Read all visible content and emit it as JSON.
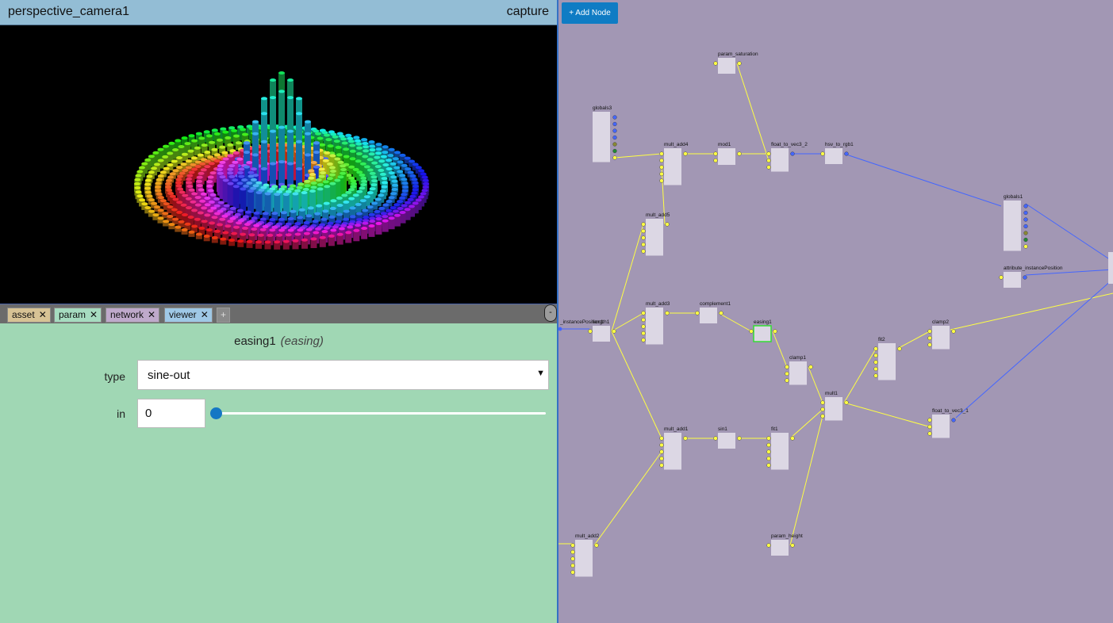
{
  "viewer": {
    "title": "perspective_camera1",
    "capture_label": "capture"
  },
  "tabs": [
    {
      "label": "asset",
      "close": "✕"
    },
    {
      "label": "param",
      "close": "✕"
    },
    {
      "label": "network",
      "close": "✕"
    },
    {
      "label": "viewer",
      "close": "✕"
    }
  ],
  "tab_add_label": "+",
  "collapse_label": "-",
  "param": {
    "node_name": "easing1",
    "node_type": "(easing)",
    "type_label": "type",
    "type_value": "sine-out",
    "in_label": "in",
    "in_value": "0",
    "in_slider_fraction": 0
  },
  "network": {
    "add_node_label": "+ Add Node",
    "nodes": [
      {
        "id": "param_saturation",
        "label": "param_saturation"
      },
      {
        "id": "globals3",
        "label": "globals3"
      },
      {
        "id": "mult_add4",
        "label": "mult_add4"
      },
      {
        "id": "mod1",
        "label": "mod1"
      },
      {
        "id": "float_to_vec3_2",
        "label": "float_to_vec3_2"
      },
      {
        "id": "hsv_to_rgb1",
        "label": "hsv_to_rgb1"
      },
      {
        "id": "globals1",
        "label": "globals1"
      },
      {
        "id": "mult_add5",
        "label": "mult_add5"
      },
      {
        "id": "attribute_instancePosition",
        "label": "attribute_instancePosition"
      },
      {
        "id": "length1",
        "label": "length1"
      },
      {
        "id": "instancePosition_partial",
        "label": "_instancePosition1"
      },
      {
        "id": "mult_add3",
        "label": "mult_add3"
      },
      {
        "id": "complement1",
        "label": "complement1"
      },
      {
        "id": "easing1",
        "label": "easing1"
      },
      {
        "id": "clamp2",
        "label": "clamp2"
      },
      {
        "id": "fit2",
        "label": "fit2"
      },
      {
        "id": "clamp1",
        "label": "clamp1"
      },
      {
        "id": "mult1",
        "label": "mult1"
      },
      {
        "id": "float_to_vec3_1",
        "label": "float_to_vec3_1"
      },
      {
        "id": "mult_add1",
        "label": "mult_add1"
      },
      {
        "id": "sin1",
        "label": "sin1"
      },
      {
        "id": "fit1",
        "label": "fit1"
      },
      {
        "id": "mult_add2",
        "label": "mult_add2"
      },
      {
        "id": "param_height",
        "label": "param_height"
      }
    ]
  },
  "colors": {
    "viewer_header": "#93bdd5",
    "param_panel": "#a0d7b4",
    "network_bg": "#a297b4",
    "accent": "#0f7cc4",
    "float_wire": "#ffff44",
    "vec3_wire": "#4466ff"
  }
}
